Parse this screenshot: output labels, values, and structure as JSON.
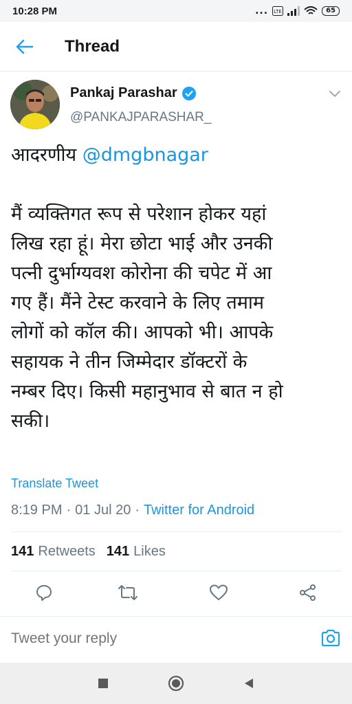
{
  "status_bar": {
    "time": "10:28 PM",
    "dots": "...",
    "network": "Vo LTE",
    "battery": "65"
  },
  "header": {
    "title": "Thread",
    "back_icon": "back-arrow-icon"
  },
  "author": {
    "name": "Pankaj Parashar",
    "handle": "@PANKAJPARASHAR_",
    "verified_icon": "verified-badge-icon",
    "accent": "#1da1f2"
  },
  "tweet": {
    "first_word": "आदरणीय ",
    "mention": "@dmgbnagar",
    "lines": [
      "मैं व्यक्तिगत रूप से परेशान होकर यहां",
      "लिख रहा हूं। मेरा छोटा भाई और उनकी",
      "पत्नी दुर्भाग्यवश कोरोना की चपेट में आ",
      "गए हैं। मैंने टेस्ट करवाने के लिए तमाम",
      "लोगों को कॉल की। आपको भी। आपके",
      "सहायक ने तीन जिम्मेदार डॉक्टरों के",
      "नम्बर दिए। किसी महानुभाव से बात न हो",
      "सकी।"
    ],
    "translate": "Translate Tweet",
    "time": "8:19 PM",
    "sep1": "·",
    "date": "01 Jul 20",
    "sep2": "·",
    "source": "Twitter for Android"
  },
  "stats": {
    "retweets_count": "141",
    "retweets_label": "Retweets",
    "likes_count": "141",
    "likes_label": "Likes"
  },
  "actions": [
    "reply-icon",
    "retweet-icon",
    "like-icon",
    "share-icon"
  ],
  "reply": {
    "placeholder": "Tweet your reply",
    "camera_icon": "camera-icon"
  },
  "navbar": [
    "recents-square-icon",
    "home-circle-icon",
    "back-triangle-icon"
  ],
  "colors": {
    "link": "#1b95e0",
    "secondary": "#657786",
    "text": "#14171a"
  }
}
